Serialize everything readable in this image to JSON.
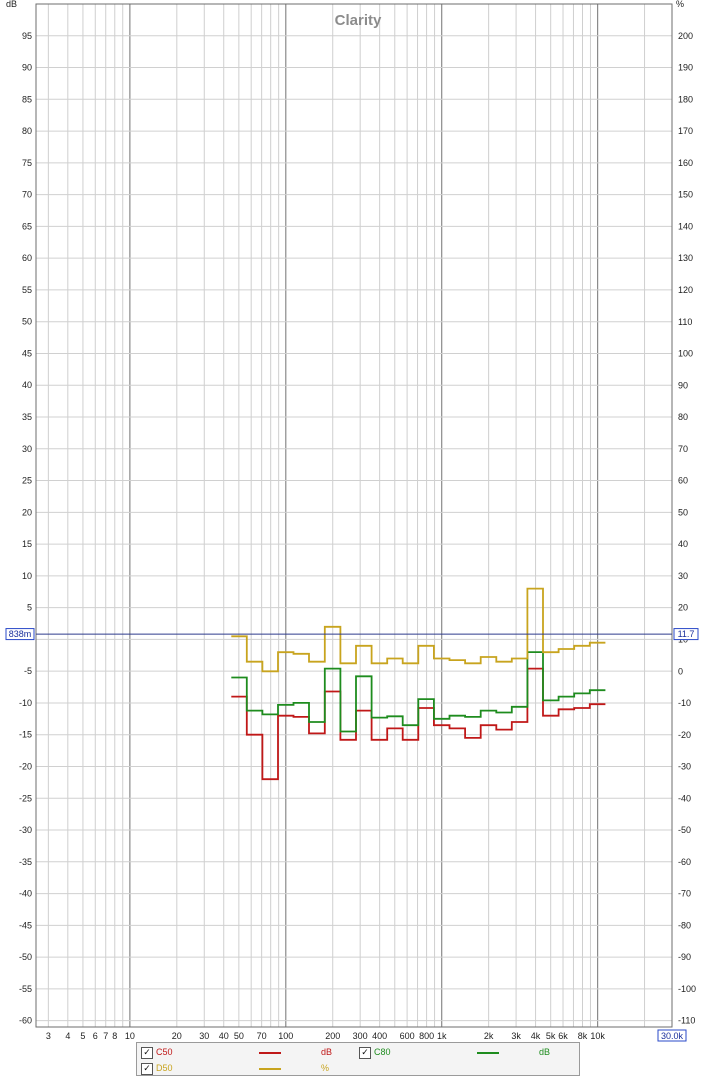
{
  "chart_data": {
    "type": "line",
    "title": "Clarity",
    "left_axis": {
      "unit_label": "dB",
      "ylim": [
        -61,
        100
      ],
      "ticks": [
        95,
        90,
        85,
        80,
        75,
        70,
        65,
        60,
        55,
        50,
        45,
        40,
        35,
        30,
        25,
        20,
        15,
        10,
        5,
        -5,
        -10,
        -15,
        -20,
        -25,
        -30,
        -35,
        -40,
        -45,
        -50,
        -55,
        -60
      ]
    },
    "right_axis": {
      "unit_label": "%",
      "ticks": [
        200,
        190,
        180,
        170,
        160,
        150,
        140,
        130,
        120,
        110,
        100,
        90,
        80,
        70,
        60,
        50,
        40,
        30,
        20,
        10,
        0,
        -10,
        -20,
        -30,
        -40,
        -50,
        -60,
        -70,
        -80,
        -90,
        -100,
        -110
      ]
    },
    "x_axis": {
      "scale": "log",
      "xlim": [
        2.5,
        30000
      ],
      "tick_values": [
        3,
        4,
        5,
        6,
        7,
        8,
        10,
        20,
        30,
        40,
        50,
        70,
        100,
        200,
        300,
        400,
        600,
        800,
        1000,
        2000,
        3000,
        4000,
        5000,
        6000,
        8000,
        10000,
        30000
      ],
      "tick_labels": [
        "3",
        "4",
        "5",
        "6",
        "7",
        "8",
        "10",
        "20",
        "30",
        "40",
        "50",
        "70",
        "100",
        "200",
        "300",
        "400",
        "600",
        "800",
        "1k",
        "2k",
        "3k",
        "4k",
        "5k",
        "6k",
        "8k",
        "10k",
        "3"
      ]
    },
    "cursor": {
      "left_readout": "838m",
      "right_readout": "11.7",
      "x_readout": "30.0k",
      "y_value_db": 0.838
    },
    "grid": true,
    "legend_position": "bottom",
    "band_edges": [
      44.7,
      56.2,
      70.8,
      89.1,
      112,
      141,
      178,
      224,
      282,
      355,
      447,
      562,
      708,
      891,
      1122,
      1413,
      1778,
      2239,
      2818,
      3548,
      4467,
      5623,
      7079,
      8913,
      11220
    ],
    "series": [
      {
        "name": "C50",
        "unit": "dB",
        "axis": "left",
        "color": "#c01818",
        "values": [
          -9.0,
          -15.0,
          -22.0,
          -12.0,
          -12.2,
          -14.8,
          -8.2,
          -15.8,
          -11.2,
          -15.8,
          -14.0,
          -15.8,
          -10.8,
          -13.5,
          -14.0,
          -15.5,
          -13.5,
          -14.2,
          -13.0,
          -4.6,
          -12.0,
          -11.0,
          -10.8,
          -10.2
        ]
      },
      {
        "name": "C80",
        "unit": "dB",
        "axis": "left",
        "color": "#1e8c1e",
        "values": [
          -6.0,
          -11.2,
          -11.8,
          -10.3,
          -10.0,
          -13.0,
          -4.6,
          -14.5,
          -5.8,
          -12.3,
          -12.1,
          -13.5,
          -9.4,
          -12.5,
          -12.0,
          -12.2,
          -11.2,
          -11.5,
          -10.6,
          -2.0,
          -9.6,
          -9.0,
          -8.5,
          -8.0
        ]
      },
      {
        "name": "D50",
        "unit": "%",
        "axis": "right",
        "color": "#c8a41e",
        "values": [
          11.0,
          3.0,
          0.0,
          6.0,
          5.5,
          3.0,
          14.0,
          2.5,
          8.0,
          2.5,
          4.0,
          2.5,
          8.0,
          4.0,
          3.5,
          2.5,
          4.5,
          3.0,
          4.0,
          26.0,
          6.0,
          7.0,
          8.0,
          9.0
        ]
      }
    ]
  },
  "legend": {
    "items": [
      {
        "name": "C50",
        "unit": "dB",
        "checked": "✓",
        "color": "#c01818"
      },
      {
        "name": "C80",
        "unit": "dB",
        "checked": "✓",
        "color": "#1e8c1e"
      },
      {
        "name": "D50",
        "unit": "%",
        "checked": "✓",
        "color": "#c8a41e"
      }
    ]
  }
}
